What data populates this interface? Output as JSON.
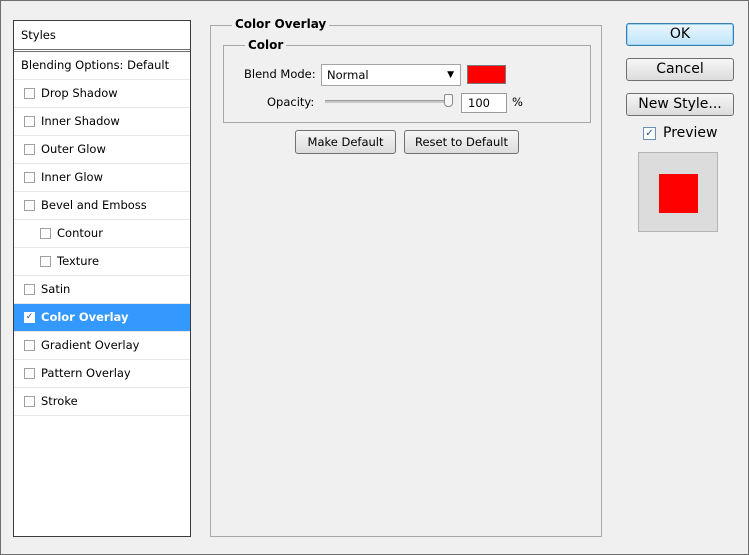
{
  "left_panel": {
    "header": "Styles",
    "blending_options": "Blending Options: Default",
    "items": [
      {
        "label": "Drop Shadow",
        "checked": false
      },
      {
        "label": "Inner Shadow",
        "checked": false
      },
      {
        "label": "Outer Glow",
        "checked": false
      },
      {
        "label": "Inner Glow",
        "checked": false
      },
      {
        "label": "Bevel and Emboss",
        "checked": false
      },
      {
        "label": "Contour",
        "checked": false
      },
      {
        "label": "Texture",
        "checked": false
      },
      {
        "label": "Satin",
        "checked": false
      },
      {
        "label": "Color Overlay",
        "checked": true,
        "selected": true
      },
      {
        "label": "Gradient Overlay",
        "checked": false
      },
      {
        "label": "Pattern Overlay",
        "checked": false
      },
      {
        "label": "Stroke",
        "checked": false
      }
    ]
  },
  "panel": {
    "title": "Color Overlay",
    "section_title": "Color",
    "blend_mode_label": "Blend Mode:",
    "blend_mode_value": "Normal",
    "overlay_color": "#ff0000",
    "opacity_label": "Opacity:",
    "opacity_value": "100",
    "opacity_unit": "%",
    "make_default_label": "Make Default",
    "reset_default_label": "Reset to Default"
  },
  "right": {
    "ok_label": "OK",
    "cancel_label": "Cancel",
    "new_style_label": "New Style...",
    "preview_label": "Preview",
    "preview_checked": true,
    "preview_color": "#ff0000"
  },
  "icons": {
    "dropdown": "chevron-down-icon",
    "check": "checkmark-icon"
  }
}
